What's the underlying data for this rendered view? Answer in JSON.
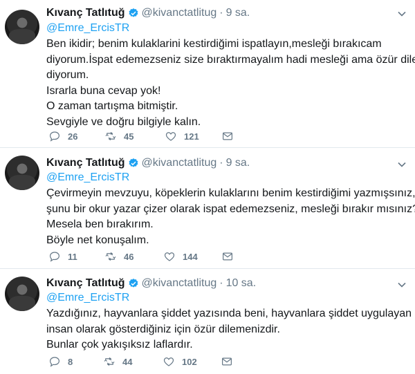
{
  "tweets": [
    {
      "author_name": "Kıvanç Tatlıtuğ",
      "handle": "@kivanctatlitug",
      "separator": "·",
      "time": "9 sa.",
      "reply_to": "@Emre_ErcisTR",
      "lines": [
        "Ben ikidir; benim kulaklarini kestirdiğimi ispatlayın,mesleği bırakıcam",
        "diyorum.İspat edemezseniz size bıraktırmayalım hadi mesleği ama özür dileyin",
        "diyorum.",
        "Israrla buna cevap yok!",
        "O zaman tartışma bitmiştir.",
        "Sevgiyle ve doğru bilgiyle kalın."
      ],
      "replies": "26",
      "retweets": "45",
      "likes": "121"
    },
    {
      "author_name": "Kıvanç Tatlıtuğ",
      "handle": "@kivanctatlitug",
      "separator": "·",
      "time": "9 sa.",
      "reply_to": "@Emre_ErcisTR",
      "lines": [
        "Çevirmeyin mevzuyu, köpeklerin kulaklarını benim kestirdiğimi yazmışsınız,",
        "şunu bir okur yazar çizer olarak ispat edemezseniz, mesleği bırakır mısınız?",
        "Mesela ben bırakırım.",
        "Böyle net konuşalım."
      ],
      "replies": "11",
      "retweets": "46",
      "likes": "144"
    },
    {
      "author_name": "Kıvanç Tatlıtuğ",
      "handle": "@kivanctatlitug",
      "separator": "·",
      "time": "10 sa.",
      "reply_to": "@Emre_ErcisTR",
      "lines": [
        "Yazdığınız, hayvanlara şiddet yazısında beni, hayvanlara şiddet uygulayan bir",
        "insan olarak gösterdiğiniz için özür dilemenizdir.",
        "Bunlar çok yakışıksız laflardır."
      ],
      "replies": "8",
      "retweets": "44",
      "likes": "102"
    }
  ],
  "colors": {
    "link": "#1da1f2",
    "secondary_text": "#657786",
    "divider": "#e1e8ed",
    "verified_badge": "#1da1f2"
  },
  "icons": [
    "verified-badge-icon",
    "chevron-down-icon",
    "reply-icon",
    "retweet-icon",
    "like-icon",
    "direct-message-icon"
  ]
}
